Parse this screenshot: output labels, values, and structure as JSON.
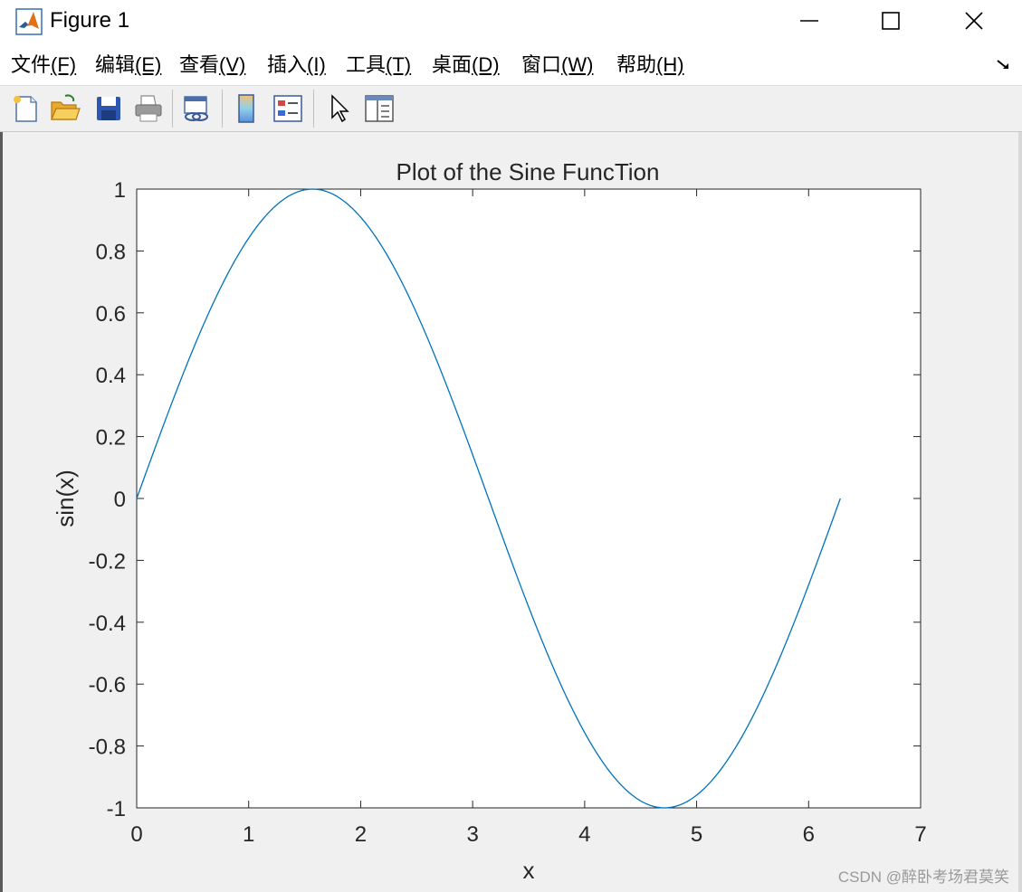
{
  "window": {
    "title": "Figure 1",
    "icon": "matlab-logo-icon",
    "controls": [
      "minimize-icon",
      "maximize-icon",
      "close-icon"
    ]
  },
  "menu": {
    "items": [
      {
        "label": "文件",
        "mnemonic": "(F)"
      },
      {
        "label": "编辑",
        "mnemonic": "(E)"
      },
      {
        "label": "查看",
        "mnemonic": "(V)"
      },
      {
        "label": "插入",
        "mnemonic": "(I)"
      },
      {
        "label": "工具",
        "mnemonic": "(T)"
      },
      {
        "label": "桌面",
        "mnemonic": "(D)"
      },
      {
        "label": "窗口",
        "mnemonic": "(W)"
      },
      {
        "label": "帮助",
        "mnemonic": "(H)"
      }
    ],
    "undock_icon": "undock-arrow-icon"
  },
  "toolbar": {
    "buttons": [
      "new-figure-icon",
      "open-file-icon",
      "save-icon",
      "print-icon",
      "link-plot-icon",
      "colorbar-icon",
      "legend-icon",
      "pointer-icon",
      "property-inspector-icon"
    ]
  },
  "chart_data": {
    "type": "line",
    "title": "Plot of the Sine FuncTion",
    "xlabel": "x",
    "ylabel": "sin(x)",
    "xlim": [
      0,
      7
    ],
    "ylim": [
      -1,
      1
    ],
    "xticks": [
      0,
      1,
      2,
      3,
      4,
      5,
      6,
      7
    ],
    "xtick_labels": [
      "0",
      "1",
      "2",
      "3",
      "4",
      "5",
      "6",
      "7"
    ],
    "yticks": [
      1,
      0.8,
      0.6,
      0.4,
      0.2,
      0,
      -0.2,
      -0.4,
      -0.6,
      -0.8,
      -1
    ],
    "ytick_labels": [
      "1",
      "0.8",
      "0.6",
      "0.4",
      "0.2",
      "0",
      "-0.2",
      "-0.4",
      "-0.6",
      "-0.8",
      "-1"
    ],
    "grid": false,
    "series": [
      {
        "color": "#0072bd",
        "x": [
          0,
          0.3927,
          0.7854,
          1.1781,
          1.5708,
          1.9635,
          2.3562,
          2.7489,
          3.1416,
          3.5343,
          3.927,
          4.3197,
          4.7124,
          5.1051,
          5.4978,
          5.8905,
          6.2832
        ],
        "y": [
          0,
          0.3827,
          0.7071,
          0.9239,
          1,
          0.9239,
          0.7071,
          0.3827,
          0,
          -0.3827,
          -0.7071,
          -0.9239,
          -1,
          -0.9239,
          -0.7071,
          -0.3827,
          0
        ]
      }
    ]
  },
  "watermark": "CSDN @醉卧考场君莫笑"
}
